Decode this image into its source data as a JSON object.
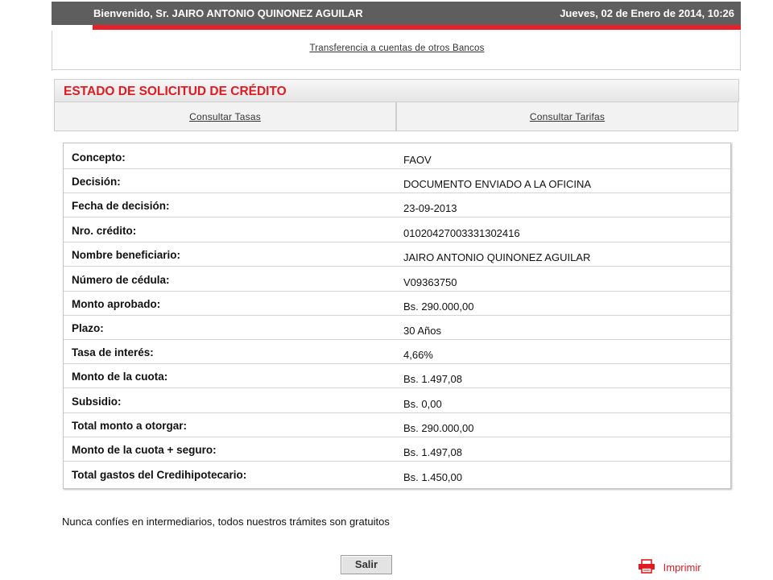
{
  "header": {
    "welcome": "Bienvenido, Sr.  JAIRO ANTONIO QUINONEZ AGUILAR",
    "date": "Jueves, 02 de Enero de 2014, 10:26"
  },
  "nav": {
    "transfer_link": "Transferencia a cuentas de otros Bancos"
  },
  "panel": {
    "title": "ESTADO DE SOLICITUD DE CRÉDITO",
    "tabs": [
      "Consultar Tasas",
      "Consultar Tarifas"
    ]
  },
  "details": [
    {
      "label": "Concepto:",
      "value": "FAOV"
    },
    {
      "label": "Decisión:",
      "value": "DOCUMENTO ENVIADO A LA OFICINA"
    },
    {
      "label": "Fecha de decisión:",
      "value": "23-09-2013"
    },
    {
      "label": "Nro. crédito:",
      "value": "01020427003331302416"
    },
    {
      "label": "Nombre beneficiario:",
      "value": "JAIRO ANTONIO QUINONEZ AGUILAR"
    },
    {
      "label": "Número de cédula:",
      "value": "V09363750"
    },
    {
      "label": "Monto aprobado:",
      "value": "Bs. 290.000,00"
    },
    {
      "label": "Plazo:",
      "value": "30 Años"
    },
    {
      "label": "Tasa de interés:",
      "value": "4,66%"
    },
    {
      "label": "Monto de la cuota:",
      "value": "Bs. 1.497,08"
    },
    {
      "label": "Subsidio:",
      "value": "Bs. 0,00"
    },
    {
      "label": "Total monto a otorgar:",
      "value": "Bs. 290.000,00"
    },
    {
      "label": "Monto de la cuota + seguro:",
      "value": "Bs. 1.497,08"
    },
    {
      "label": "Total gastos del Credihipotecario:",
      "value": "Bs. 1.450,00"
    }
  ],
  "footer": {
    "notice": "Nunca confíes en intermediarios, todos nuestros trámites son gratuitos",
    "exit_label": "Salir",
    "print_label": "Imprimir",
    "print_icon": "printer-icon"
  },
  "colors": {
    "brand_red": "#e8202a",
    "header_gray": "#5e5e5e"
  }
}
